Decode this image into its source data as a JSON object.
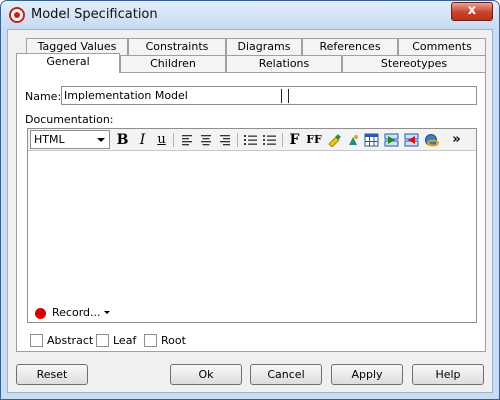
{
  "window": {
    "title": "Model Specification",
    "close_label": "x"
  },
  "tabs": {
    "top": [
      "Tagged Values",
      "Constraints",
      "Diagrams",
      "References",
      "Comments"
    ],
    "bottom": [
      "General",
      "Children",
      "Relations",
      "Stereotypes"
    ],
    "active": "General"
  },
  "general": {
    "name_label": "Name:",
    "name_value": "Implementation Model",
    "documentation_label": "Documentation:",
    "format_select": {
      "selected": "HTML"
    },
    "toolbar": {
      "bold": "B",
      "italic": "I",
      "underline": "u",
      "font": "F",
      "font_size": "FF",
      "more": "»"
    },
    "record_label": "Record...",
    "checkboxes": [
      {
        "label": "Abstract",
        "checked": false
      },
      {
        "label": "Leaf",
        "checked": false
      },
      {
        "label": "Root",
        "checked": false
      }
    ]
  },
  "buttons": {
    "reset": "Reset",
    "ok": "Ok",
    "cancel": "Cancel",
    "apply": "Apply",
    "help": "Help"
  },
  "colors": {
    "title_bar": "#c8dcf3",
    "close_button": "#c8432b",
    "record_dot": "#d10000"
  }
}
